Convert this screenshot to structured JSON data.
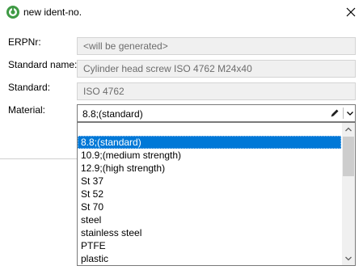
{
  "window": {
    "title": "new ident-no.",
    "accent_color": "#3f9a45"
  },
  "form": {
    "erpnr_label": "ERPNr:",
    "erpnr_value": "<will be generated>",
    "standard_name_label": "Standard name:",
    "standard_name_value": "Cylinder head screw ISO 4762 M24x40",
    "standard_label": "Standard:",
    "standard_value": "ISO 4762",
    "material_label": "Material:",
    "material_value": "8.8;(standard)"
  },
  "dropdown": {
    "selected_index": 1,
    "selection_color": "#0078d7",
    "options": [
      "",
      "8.8;(standard)",
      "10.9;(medium strength)",
      "12.9;(high strength)",
      "St 37",
      "St 52",
      "St 70",
      "steel",
      "stainless steel",
      "PTFE",
      "plastic"
    ]
  }
}
